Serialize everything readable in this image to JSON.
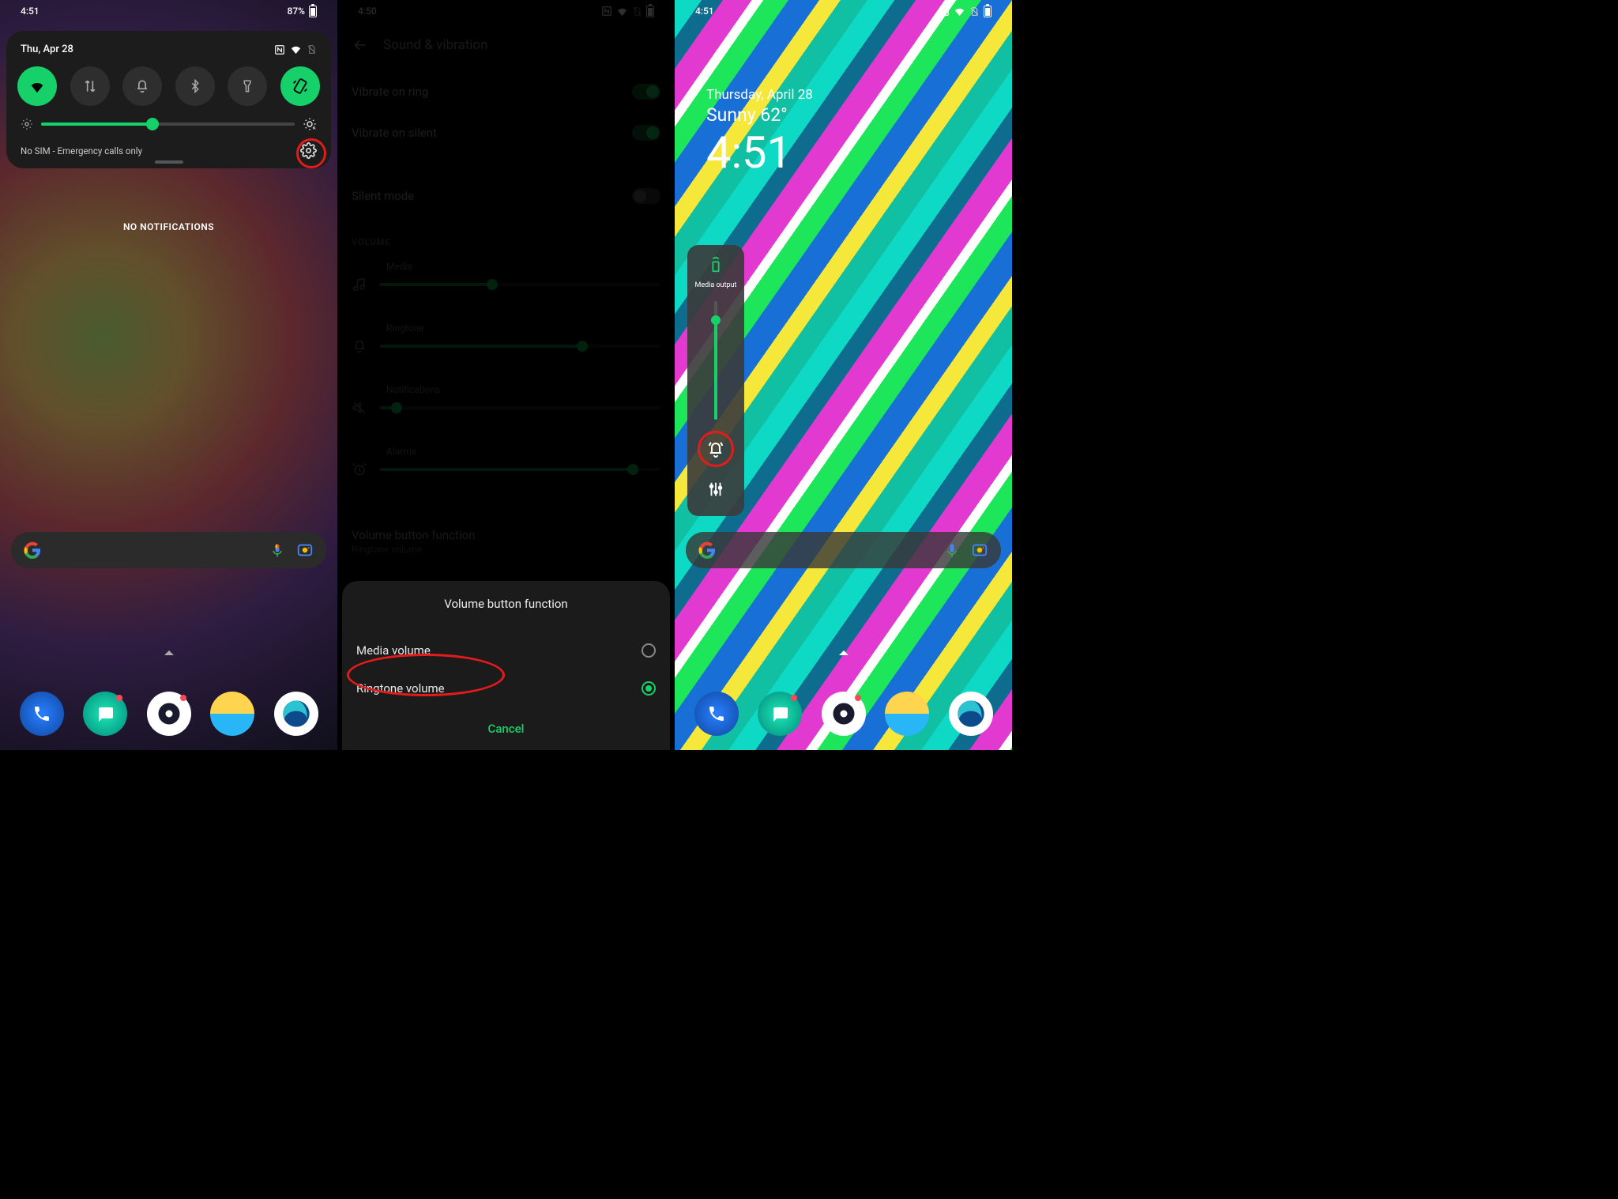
{
  "phone1": {
    "status": {
      "time": "4:51",
      "battery_text": "87%"
    },
    "panel": {
      "date": "Thu, Apr 28",
      "toggles": [
        {
          "name": "wifi",
          "on": true
        },
        {
          "name": "mobile-data",
          "on": false
        },
        {
          "name": "ring-mode",
          "on": false
        },
        {
          "name": "bluetooth",
          "on": false
        },
        {
          "name": "flashlight",
          "on": false
        },
        {
          "name": "rotation",
          "on": true
        }
      ],
      "brightness_pct": 44,
      "footer_text": "No SIM - Emergency calls only"
    },
    "no_notifications": "NO NOTIFICATIONS",
    "dock_apps": [
      "phone",
      "messages",
      "camera",
      "weather",
      "edge"
    ]
  },
  "phone2": {
    "status": {
      "time": "4:50"
    },
    "page_title": "Sound & vibration",
    "rows": {
      "vibrate_on_ring": {
        "label": "Vibrate on ring",
        "on": true
      },
      "vibrate_on_silent": {
        "label": "Vibrate on silent",
        "on": true
      },
      "silent_mode": {
        "label": "Silent mode",
        "on": false
      }
    },
    "section_volume": "VOLUME",
    "volumes": {
      "media": {
        "label": "Media",
        "pct": 40
      },
      "ringtone": {
        "label": "Ringtone",
        "pct": 72
      },
      "notifications": {
        "label": "Notifications",
        "pct": 6
      },
      "alarms": {
        "label": "Alarms",
        "pct": 90
      }
    },
    "vbf": {
      "title": "Volume button function",
      "subtitle": "Ringtone volume"
    },
    "sheet": {
      "title": "Volume button function",
      "options": [
        {
          "label": "Media volume",
          "selected": false
        },
        {
          "label": "Ringtone volume",
          "selected": true
        }
      ],
      "cancel": "Cancel"
    }
  },
  "phone3": {
    "status": {
      "time": "4:51"
    },
    "widget": {
      "date": "Thursday, April 28",
      "weather": "Sunny 62°",
      "time": "4:51"
    },
    "volpop": {
      "media_output": "Media output",
      "volume_pct": 84
    },
    "dock_apps": [
      "phone",
      "messages",
      "camera",
      "weather",
      "edge"
    ]
  }
}
